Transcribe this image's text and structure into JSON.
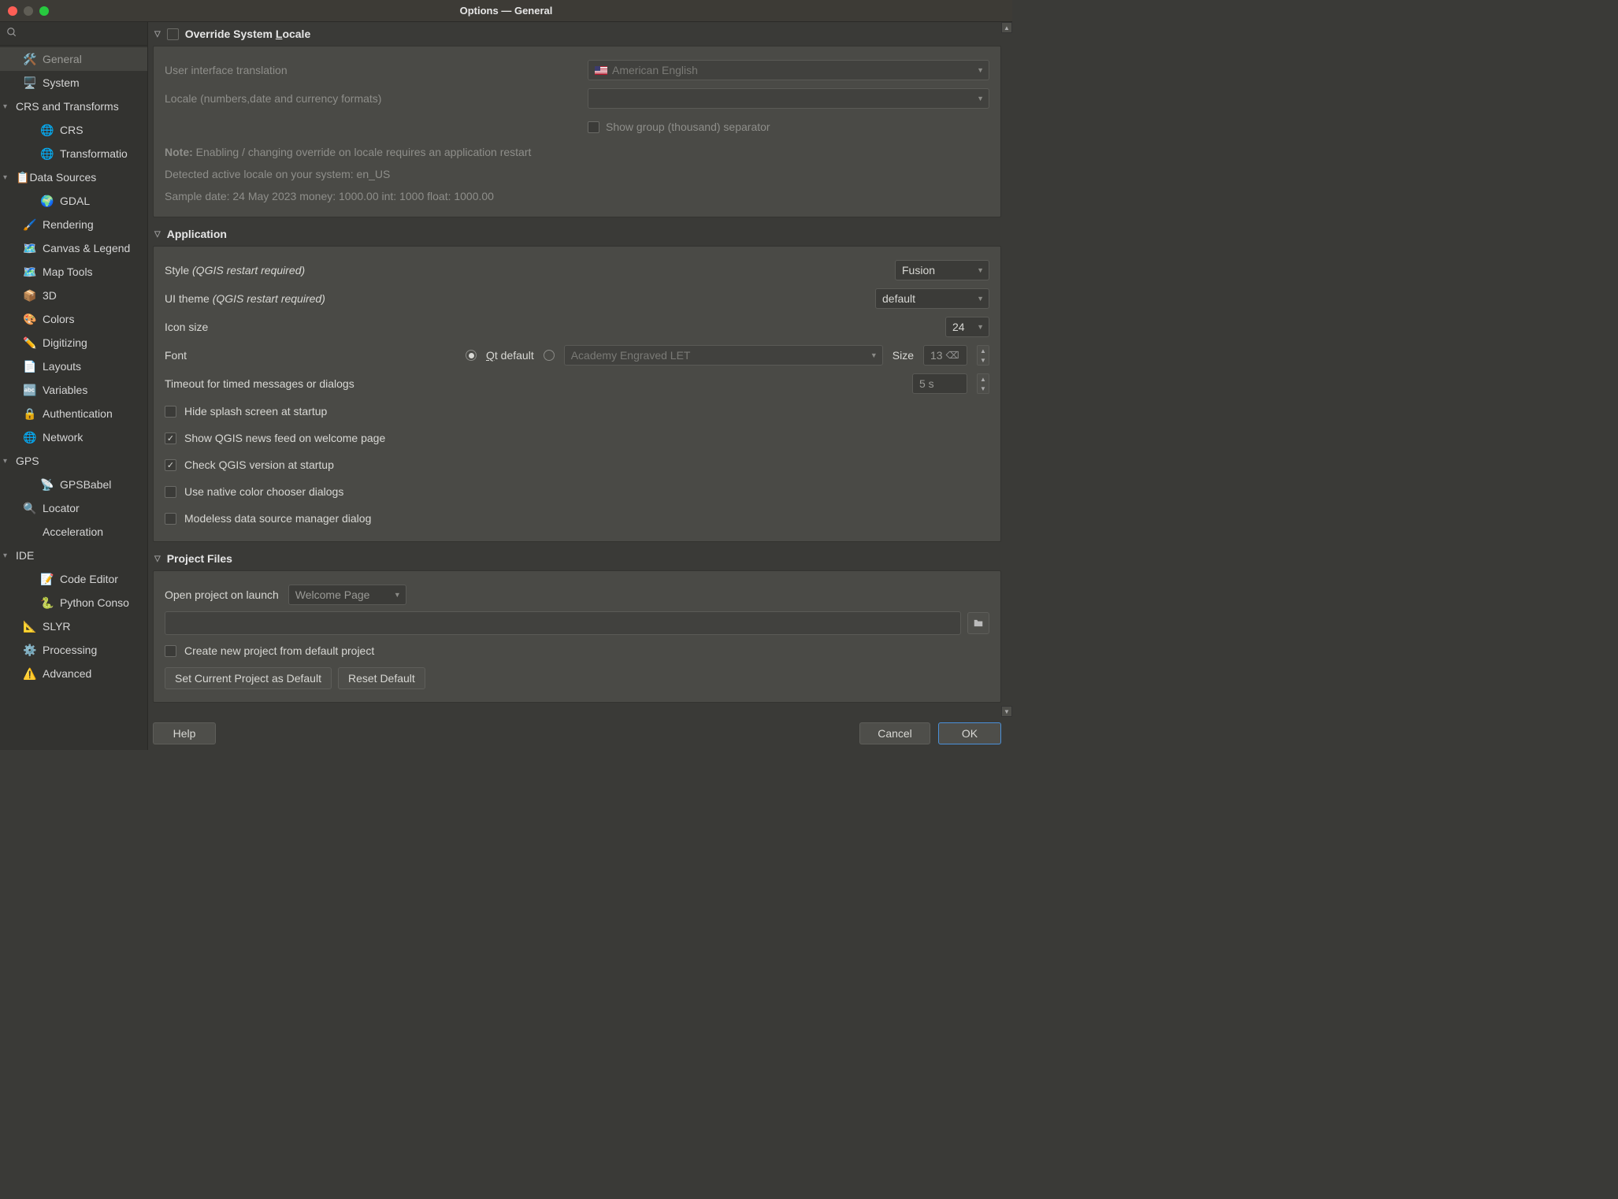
{
  "titlebar": {
    "title": "Options — General"
  },
  "sidebar": {
    "items": [
      {
        "kind": "item",
        "level": 1,
        "icon": "🛠️",
        "label": "General",
        "selected": true
      },
      {
        "kind": "item",
        "level": 1,
        "icon": "🖥️",
        "label": "System"
      },
      {
        "kind": "group",
        "label": "CRS and Transforms"
      },
      {
        "kind": "item",
        "level": 2,
        "icon": "🌐",
        "label": "CRS"
      },
      {
        "kind": "item",
        "level": 2,
        "icon": "🌐",
        "label": "Transformatio"
      },
      {
        "kind": "group",
        "label": "Data Sources",
        "icon": "📋"
      },
      {
        "kind": "item",
        "level": 2,
        "icon": "🌍",
        "label": "GDAL"
      },
      {
        "kind": "item",
        "level": 1,
        "icon": "🖌️",
        "label": "Rendering"
      },
      {
        "kind": "item",
        "level": 1,
        "icon": "🗺️",
        "label": "Canvas & Legend"
      },
      {
        "kind": "item",
        "level": 1,
        "icon": "🗺️",
        "label": "Map Tools"
      },
      {
        "kind": "item",
        "level": 1,
        "icon": "📦",
        "label": "3D"
      },
      {
        "kind": "item",
        "level": 1,
        "icon": "🎨",
        "label": "Colors"
      },
      {
        "kind": "item",
        "level": 1,
        "icon": "✏️",
        "label": "Digitizing"
      },
      {
        "kind": "item",
        "level": 1,
        "icon": "📄",
        "label": "Layouts"
      },
      {
        "kind": "item",
        "level": 1,
        "icon": "🔤",
        "label": "Variables"
      },
      {
        "kind": "item",
        "level": 1,
        "icon": "🔒",
        "label": "Authentication"
      },
      {
        "kind": "item",
        "level": 1,
        "icon": "🌐",
        "label": "Network"
      },
      {
        "kind": "group",
        "label": "GPS"
      },
      {
        "kind": "item",
        "level": 2,
        "icon": "📡",
        "label": "GPSBabel"
      },
      {
        "kind": "item",
        "level": 1,
        "icon": "🔍",
        "label": "Locator"
      },
      {
        "kind": "item",
        "level": 1,
        "icon": "",
        "label": "Acceleration"
      },
      {
        "kind": "group",
        "label": "IDE"
      },
      {
        "kind": "item",
        "level": 2,
        "icon": "📝",
        "label": "Code Editor"
      },
      {
        "kind": "item",
        "level": 2,
        "icon": "🐍",
        "label": "Python Conso"
      },
      {
        "kind": "item",
        "level": 1,
        "icon": "📐",
        "label": "SLYR"
      },
      {
        "kind": "item",
        "level": 1,
        "icon": "⚙️",
        "label": "Processing"
      },
      {
        "kind": "item",
        "level": 1,
        "icon": "⚠️",
        "label": "Advanced"
      }
    ]
  },
  "sections": {
    "locale": {
      "title_prefix": "Override System ",
      "title_letter": "L",
      "title_suffix": "ocale",
      "ui_translation_label": "User interface translation",
      "ui_translation_value": "American English",
      "locale_format_label": "Locale (numbers,date and currency formats)",
      "thousand_sep_label": "Show group (thousand) separator",
      "note_prefix": "Note:",
      "note_text": " Enabling / changing override on locale requires an application restart",
      "detected": "Detected active locale on your system: en_US",
      "sample": "Sample date: 24 May 2023 money: 1000.00 int: 1000 float: 1000.00"
    },
    "application": {
      "title": "Application",
      "style_label_a": "Style ",
      "style_label_b": "(QGIS restart required)",
      "style_value": "Fusion",
      "theme_label_a": "UI theme ",
      "theme_label_b": "(QGIS restart required)",
      "theme_value": "default",
      "icon_size_label": "Icon size",
      "icon_size_value": "24",
      "font_label": "Font",
      "font_qt_a": "Q",
      "font_qt_b": "t default",
      "font_custom_value": "Academy Engraved LET",
      "font_size_label": "Size",
      "font_size_value": "13",
      "timeout_label": "Timeout for timed messages or dialogs",
      "timeout_value": "5 s",
      "chk_hide_splash": "Hide splash screen at startup",
      "chk_news": "Show QGIS news feed on welcome page",
      "chk_version": "Check QGIS version at startup",
      "chk_native_color": "Use native color chooser dialogs",
      "chk_modeless": "Modeless data source manager dialog"
    },
    "project": {
      "title": "Project Files",
      "open_label": "Open project on launch",
      "open_value": "Welcome Page",
      "chk_create_default": "Create new project from default project",
      "btn_set_current": "Set Current Project as Default",
      "btn_reset": "Reset Default"
    }
  },
  "footer": {
    "help": "Help",
    "cancel": "Cancel",
    "ok": "OK"
  }
}
